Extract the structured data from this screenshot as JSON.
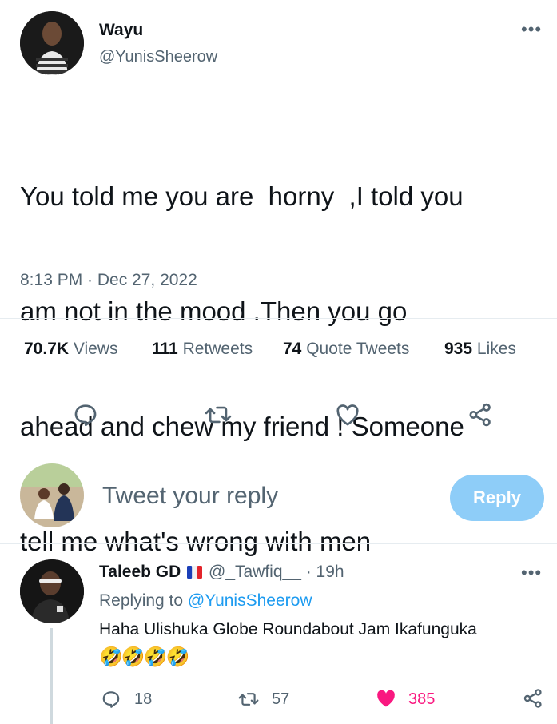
{
  "tweet": {
    "author_name": "Wayu",
    "author_handle": "@YunisSheerow",
    "more": "•••",
    "text_lines": [
      "You told me you are  horny  ,I told you",
      "am not in the mood .Then you go",
      "ahead and chew my friend ! Someone",
      "tell me what's wrong with men"
    ],
    "timestamp": "8:13 PM · Dec 27, 2022",
    "stats": {
      "views_count": "70.7K",
      "views_label": "Views",
      "retweets_count": "111",
      "retweets_label": "Retweets",
      "quotes_count": "74",
      "quotes_label": "Quote Tweets",
      "likes_count": "935",
      "likes_label": "Likes"
    },
    "actions": [
      "reply-icon",
      "retweet-icon",
      "like-icon",
      "share-icon"
    ]
  },
  "composer": {
    "placeholder": "Tweet your reply",
    "button_label": "Reply"
  },
  "reply": {
    "author_name": "Taleeb GD",
    "flag": "France flag",
    "author_handle": "@_Tawfiq__",
    "time": "· 19h",
    "more": "•••",
    "replying_to_prefix": "Replying to",
    "replying_to_handle": "@YunisSheerow",
    "text": "Haha Ulishuka Globe Roundabout Jam Ikafunguka",
    "emoji": "🤣🤣🤣🤣",
    "reply_count": "18",
    "retweet_count": "57",
    "like_count": "385"
  },
  "colors": {
    "primary_text": "#0f1419",
    "secondary_text": "#536471",
    "link": "#1d9bf0",
    "reply_button": "#8ecdf8",
    "like_red": "#f91880",
    "divider": "#e6ecf0"
  }
}
